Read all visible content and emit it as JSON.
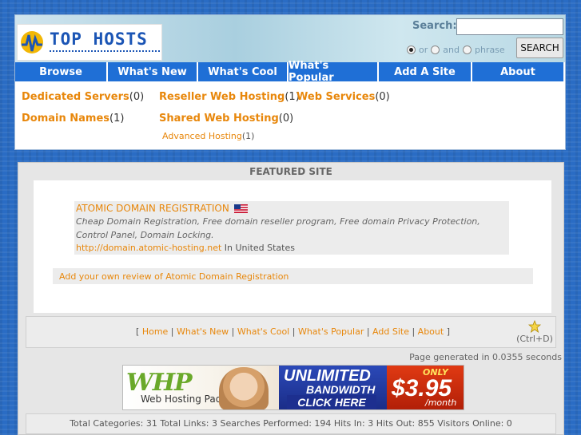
{
  "header": {
    "logo_text": "TOP HOSTS",
    "search_label": "Search:",
    "search_value": "",
    "search_options": [
      "or",
      "and",
      "phrase"
    ],
    "search_selected": "or",
    "search_button": "SEARCH"
  },
  "nav": [
    "Browse",
    "What's New",
    "What's Cool",
    "What's Popular",
    "Add A Site",
    "About"
  ],
  "categories": [
    {
      "name": "Dedicated Servers",
      "count": "(0)"
    },
    {
      "name": "Reseller Web Hosting",
      "count": "(1)"
    },
    {
      "name": "Web Services",
      "count": "(0)"
    },
    {
      "name": "Domain Names",
      "count": "(1)"
    },
    {
      "name": "Shared Web Hosting",
      "count": "(0)"
    }
  ],
  "subcategory": {
    "name": "Advanced Hosting",
    "count": "(1)"
  },
  "featured": {
    "title": "FEATURED SITE",
    "site_name": "ATOMIC DOMAIN REGISTRATION",
    "description": "Cheap Domain Registration, Free domain reseller program, Free domain Privacy Protection, Control Panel, Domain Locking.",
    "url": "http://domain.atomic-hosting.net",
    "location": "In United States",
    "review_link": "Add your own review of Atomic Domain Registration",
    "flag_icon": "us-flag-icon"
  },
  "footer": {
    "links": [
      "Home",
      "What's New",
      "What's Cool",
      "What's Popular",
      "Add Site",
      "About"
    ],
    "open_bracket": "[",
    "close_bracket": "]",
    "bookmark_hint": "(Ctrl+D)",
    "bookmark_icon": "star-icon",
    "generated": "Page generated in 0.0355 seconds"
  },
  "banner": {
    "brand": "WHP",
    "brand_sub": "Web Hosting Pad",
    "headline": "UNLIMITED",
    "subheadline": "BANDWIDTH",
    "cta": "CLICK HERE",
    "only": "ONLY",
    "price": "$3.95",
    "per": "/month"
  },
  "stats": "Total Categories: 31  Total Links: 3  Searches Performed: 194  Hits In: 3  Hits Out: 855  Visitors Online: 0",
  "colors": {
    "nav_blue": "#1f6fd6",
    "link_orange": "#e8870b",
    "page_blue": "#2a6cc4"
  }
}
